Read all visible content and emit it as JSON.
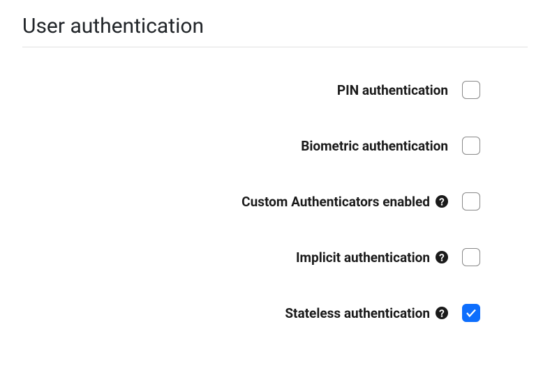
{
  "section": {
    "title": "User authentication"
  },
  "options": {
    "pin": {
      "label": "PIN authentication",
      "has_help": false,
      "checked": false
    },
    "biometric": {
      "label": "Biometric authentication",
      "has_help": false,
      "checked": false
    },
    "custom": {
      "label": "Custom Authenticators enabled",
      "has_help": true,
      "checked": false
    },
    "implicit": {
      "label": "Implicit authentication",
      "has_help": true,
      "checked": false
    },
    "stateless": {
      "label": "Stateless authentication",
      "has_help": true,
      "checked": true
    }
  }
}
